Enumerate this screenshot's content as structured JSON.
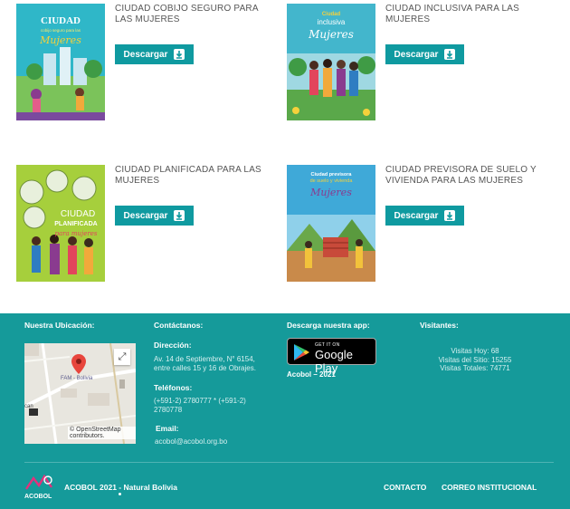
{
  "publications": [
    {
      "title": "CIUDAD COBIJO SEGURO PARA LAS MUJERES",
      "button_label": "Descargar",
      "cover_text": {
        "line1": "CIUDAD",
        "line2": "cobijo seguro para las",
        "line3": "Mujeres"
      }
    },
    {
      "title": "CIUDAD INCLUSIVA PARA LAS MUJERES",
      "button_label": "Descargar",
      "cover_text": {
        "line1": "Ciudad",
        "line2": "inclusiva",
        "line3": "Mujeres"
      }
    },
    {
      "title": "CIUDAD PLANIFICADA PARA LAS MUJERES",
      "button_label": "Descargar",
      "cover_text": {
        "line1": "CIUDAD",
        "line2": "PLANIFICADA",
        "line3": "para mujeres"
      }
    },
    {
      "title": "CIUDAD PREVISORA DE SUELO Y VIVIENDA PARA LAS MUJERES",
      "button_label": "Descargar",
      "cover_text": {
        "line1": "Ciudad previsora",
        "line2": "de suelo y vivienda",
        "line3": "Mujeres"
      }
    }
  ],
  "footer": {
    "location_heading": "Nuestra Ubicación:",
    "map": {
      "place_label": "FAM - Bolivia",
      "credit": "© OpenStreetMap contributors.",
      "side_label": "can"
    },
    "contact_heading": "Contáctanos:",
    "address_label": "Dirección:",
    "address": "Av. 14 de Septiembre, N° 6154, entre calles 15 y 16 de Obrajes.",
    "phones_label": "Teléfonos:",
    "phones": "(+591-2) 2780777 * (+591-2) 2780778",
    "email_label": "Email:",
    "email": "acobol@acobol.org.bo",
    "app_heading": "Descarga nuestra app:",
    "store_badge": {
      "small": "GET IT ON",
      "big": "Google Play"
    },
    "app_caption": "Acobol – 2021",
    "visitors_heading": "Visitantes:",
    "visits_today": "Visitas Hoy: 68",
    "visits_site": "Visitas del Sitio: 15255",
    "visits_total": "Visitas Totales: 74771",
    "logo_text": "ACOBOL",
    "copyright": "ACOBOL 2021 - Natural Bolivia",
    "links": [
      "CONTACTO",
      "CORREO INSTITUCIONAL"
    ]
  },
  "colors": {
    "accent": "#0f9aa0",
    "footer_bg": "#159a9a"
  }
}
